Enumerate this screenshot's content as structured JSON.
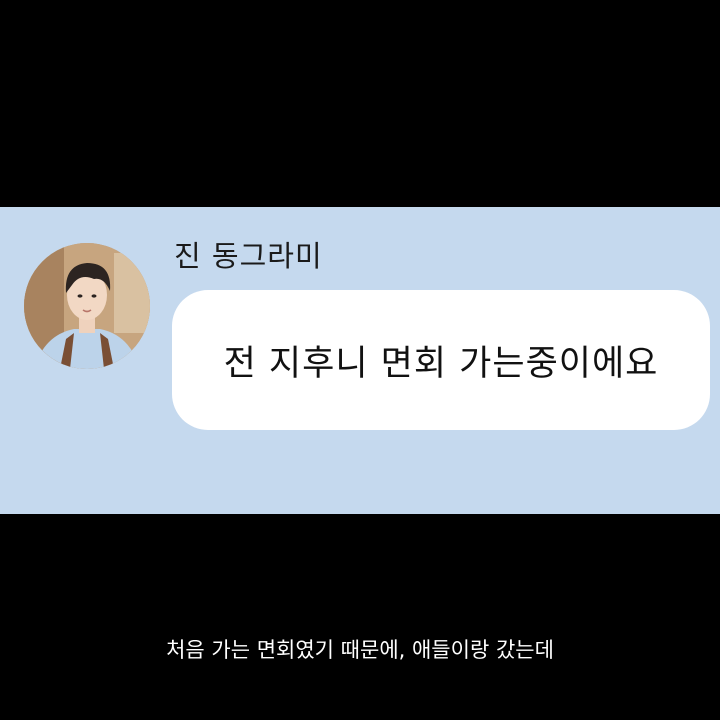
{
  "chat": {
    "sender_name": "진 동그라미",
    "message": "전 지후니 면회 가는중이에요",
    "panel_color": "#c5d9ee",
    "bubble_color": "#ffffff"
  },
  "caption": {
    "text": "처음 가는 면회였기 때문에, 애들이랑 갔는데"
  },
  "icons": {
    "avatar": "profile-photo"
  }
}
